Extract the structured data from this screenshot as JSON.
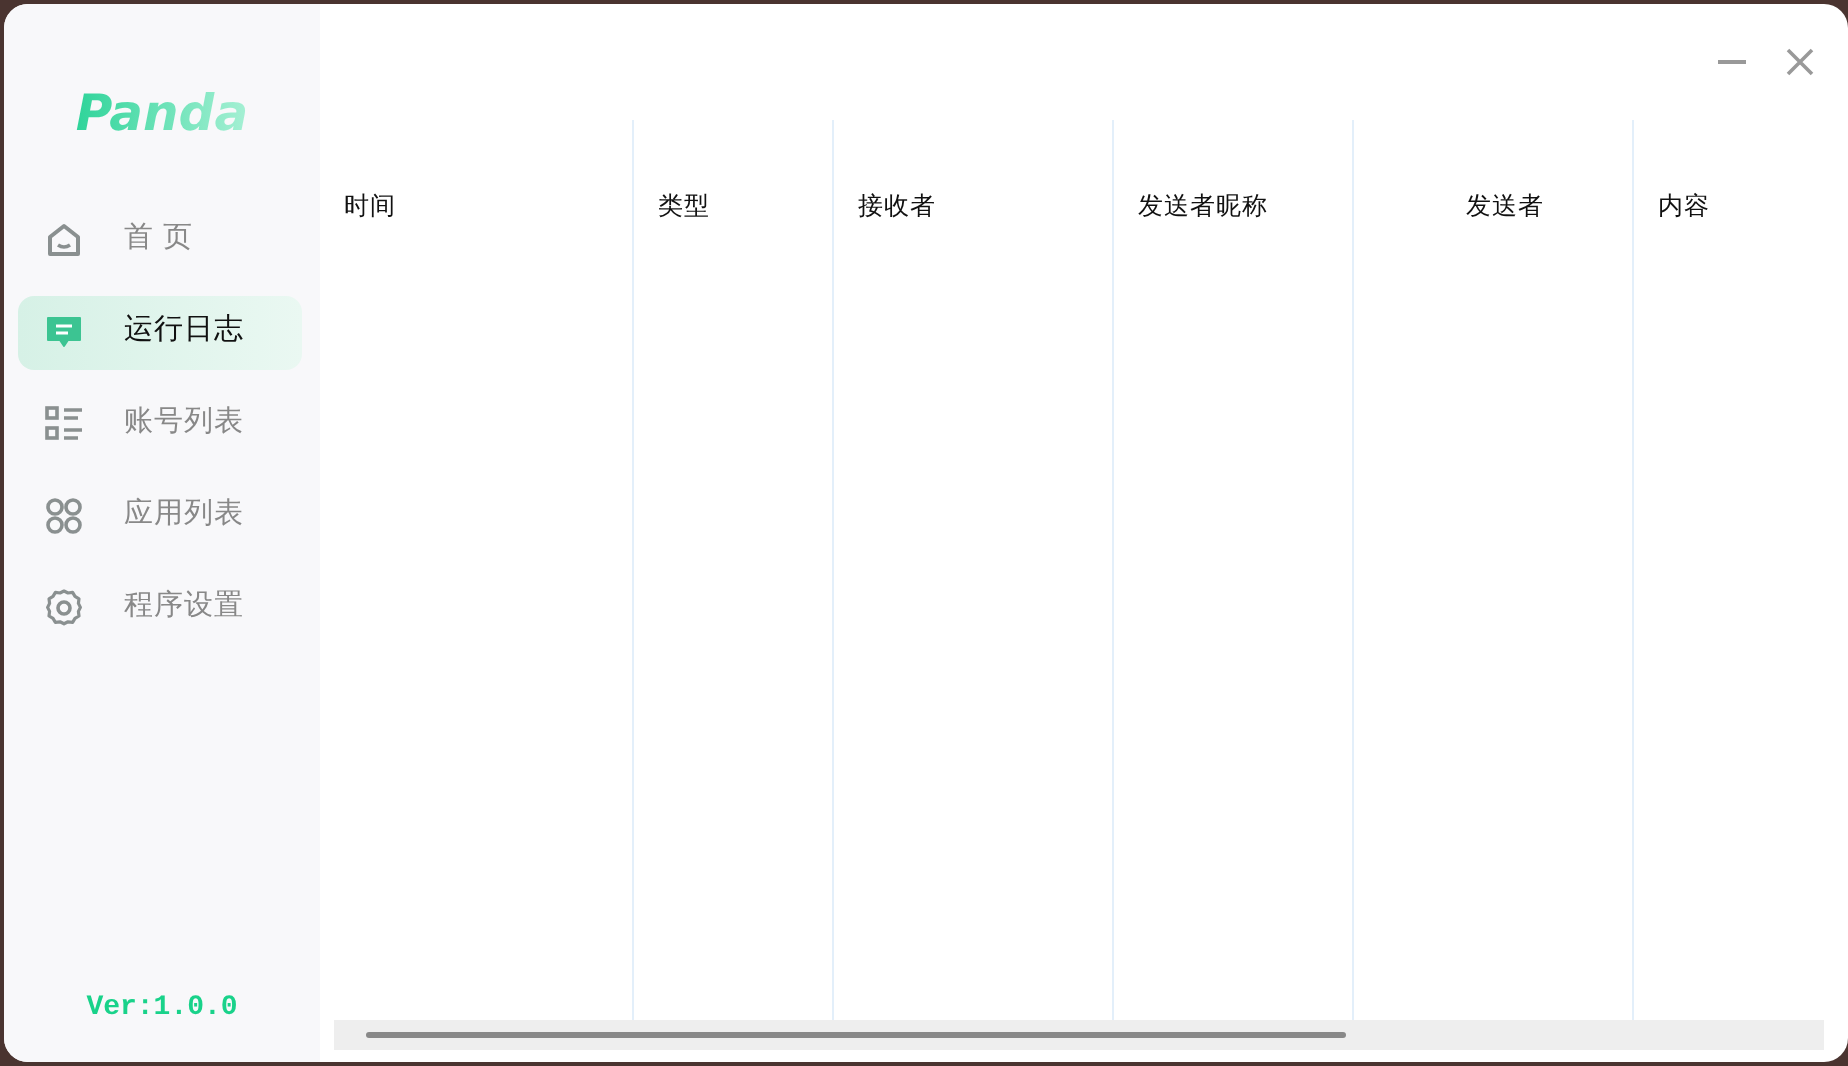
{
  "app": {
    "logo": "Panda",
    "version": "Ver:1.0.0"
  },
  "sidebar": {
    "items": [
      {
        "kind": "home",
        "label": "首 页",
        "selected": false
      },
      {
        "kind": "log",
        "label": "运行日志",
        "selected": true
      },
      {
        "kind": "list",
        "label": "账号列表",
        "selected": false
      },
      {
        "kind": "apps",
        "label": "应用列表",
        "selected": false
      },
      {
        "kind": "settings",
        "label": "程序设置",
        "selected": false
      }
    ]
  },
  "table": {
    "columns": [
      {
        "label": "时间",
        "kind": "start"
      },
      {
        "label": "类型",
        "kind": "start"
      },
      {
        "label": "接收者",
        "kind": "start"
      },
      {
        "label": "发送者昵称",
        "kind": "start"
      },
      {
        "label": "发送者",
        "kind": "centered"
      },
      {
        "label": "内容",
        "kind": "start"
      }
    ]
  }
}
